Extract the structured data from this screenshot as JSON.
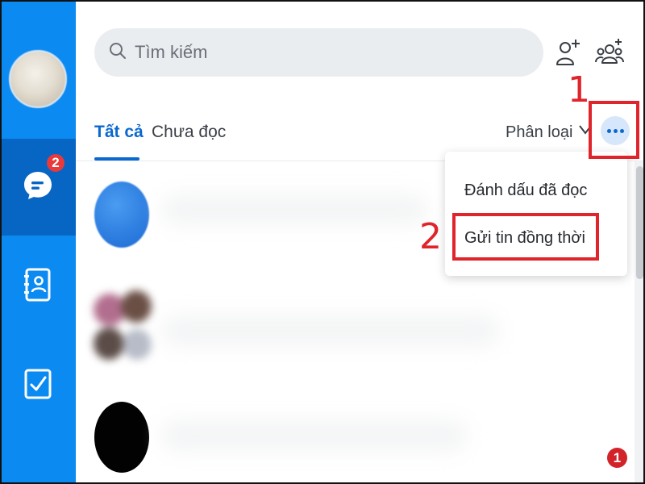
{
  "colors": {
    "rail": "#0B8AF2",
    "rail_active": "#0766C4",
    "accent": "#0A68CF",
    "badge": "#E9393B",
    "annotation": "#E0242C"
  },
  "sidebar": {
    "items": [
      {
        "name": "messages",
        "icon": "chat-icon",
        "badge": "2",
        "active": true
      },
      {
        "name": "contacts",
        "icon": "contact-book-icon"
      },
      {
        "name": "todo",
        "icon": "checkbox-icon"
      }
    ]
  },
  "search": {
    "placeholder": "Tìm kiếm",
    "icon": "search-icon"
  },
  "header_actions": [
    {
      "name": "add-friend",
      "icon": "add-friend-icon"
    },
    {
      "name": "create-group",
      "icon": "add-group-icon"
    }
  ],
  "tabs": [
    {
      "label": "Tất cả",
      "active": true
    },
    {
      "label": "Chưa đọc",
      "active": false
    }
  ],
  "filter": {
    "label": "Phân loại",
    "icon": "chevron-down-icon"
  },
  "more_button": {
    "icon": "more-dots-icon"
  },
  "menu": {
    "items": [
      {
        "label": "Đánh dấu đã đọc"
      },
      {
        "label": "Gửi tin đồng thời"
      }
    ]
  },
  "annotations": {
    "step1": "1",
    "step2": "2",
    "watermark": "1"
  }
}
